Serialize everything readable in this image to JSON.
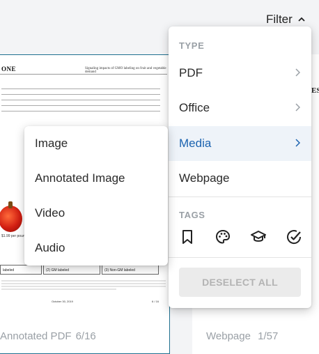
{
  "header": {
    "filter_label": "Filter"
  },
  "background_cards": {
    "left": {
      "logo": "ONE",
      "doc_title": "Signaling impacts of GMO labeling on fruit and vegetable demand",
      "price": "$1.99 per pound",
      "box_labels": [
        "labeled",
        "(2) GM labeled",
        "(3) Non-GM labeled"
      ],
      "footer_date": "October 30, 2019",
      "footer_page": "6 / 16",
      "type_label": "Annotated PDF",
      "page_count": "6/16"
    },
    "right": {
      "heading": "ESE",
      "type_label": "Webpage",
      "page_count": "1/57"
    }
  },
  "filter_menu": {
    "type_section": "TYPE",
    "types": [
      {
        "label": "PDF",
        "has_submenu": true
      },
      {
        "label": "Office",
        "has_submenu": true
      },
      {
        "label": "Media",
        "has_submenu": true,
        "active": true
      },
      {
        "label": "Webpage",
        "has_submenu": false
      }
    ],
    "tags_section": "TAGS",
    "tags": [
      "bookmark-icon",
      "palette-icon",
      "graduation-cap-icon",
      "check-circle-icon"
    ],
    "deselect_all": "DESELECT ALL"
  },
  "media_submenu": {
    "items": [
      "Image",
      "Annotated Image",
      "Video",
      "Audio"
    ]
  },
  "colors": {
    "accent": "#1c63b0",
    "active_bg": "#eef3f9",
    "section_title": "#9aa0a6"
  }
}
